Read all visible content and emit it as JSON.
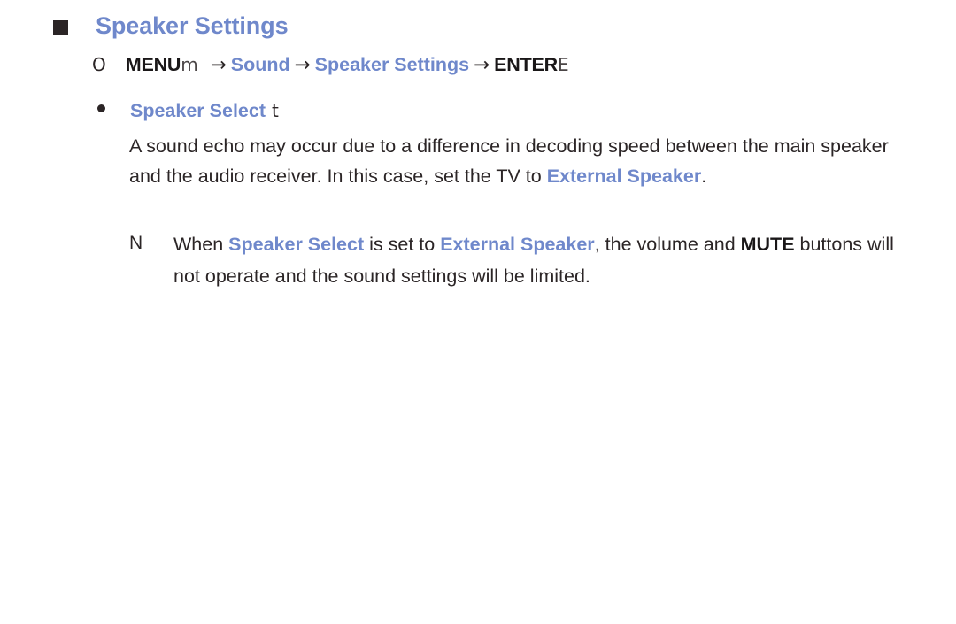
{
  "page": {
    "background_color": "#ffffff",
    "text_color": "#2b2526",
    "accent_color": "#6f88cb",
    "marker_color": "#2b2526"
  },
  "section": {
    "marker_icon": "filled-square-bullet",
    "title": "Speaker Settings"
  },
  "menu_path": {
    "marker_icon": "circle-outline-bullet",
    "marker_glyph": "O",
    "menu_label": "MENU",
    "menu_symbol": "m",
    "arrow": "→",
    "step_sound": "Sound",
    "step_speaker_settings": "Speaker Settings",
    "enter_label": "ENTER",
    "enter_symbol": "E"
  },
  "bullet_item": {
    "marker_icon": "filled-dot-bullet",
    "label": "Speaker Select",
    "symbol": "t"
  },
  "body": {
    "segments": [
      {
        "text": "A sound echo may occur due to a difference in decoding speed between the main speaker and the audio receiver. In this case, set the TV to ",
        "style": "normal"
      },
      {
        "text": "External Speaker",
        "style": "blue-bold"
      },
      {
        "text": ".",
        "style": "normal"
      }
    ]
  },
  "note": {
    "marker_glyph": "N",
    "marker_icon": "note-n-marker",
    "segments": [
      {
        "text": "When ",
        "style": "normal"
      },
      {
        "text": "Speaker Select",
        "style": "blue-bold"
      },
      {
        "text": " is set to ",
        "style": "normal"
      },
      {
        "text": "External Speaker",
        "style": "blue-bold"
      },
      {
        "text": ", the volume and ",
        "style": "normal"
      },
      {
        "text": "MUTE",
        "style": "black-bold"
      },
      {
        "text": " buttons will not operate and the sound settings will be limited.",
        "style": "normal"
      }
    ]
  }
}
